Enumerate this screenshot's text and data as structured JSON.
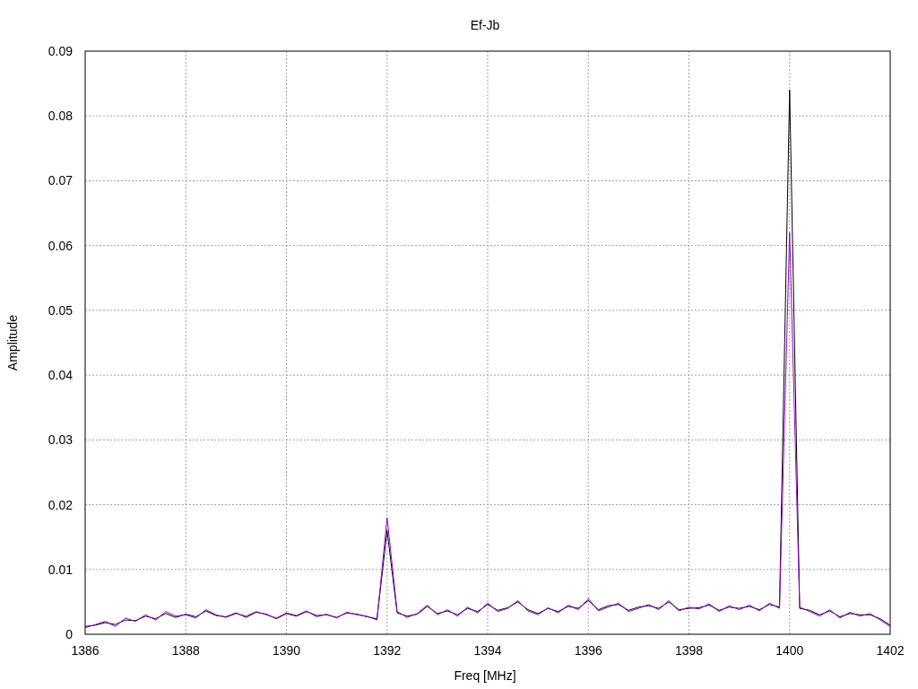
{
  "chart_data": {
    "type": "line",
    "title": "Ef-Jb",
    "xlabel": "Freq [MHz]",
    "ylabel": "Amplitude",
    "x": [
      1386,
      1386.2,
      1386.4,
      1386.6,
      1386.8,
      1387,
      1387.2,
      1387.4,
      1387.6,
      1387.8,
      1388,
      1388.2,
      1388.4,
      1388.6,
      1388.8,
      1389,
      1389.2,
      1389.4,
      1389.6,
      1389.8,
      1390,
      1390.2,
      1390.4,
      1390.6,
      1390.8,
      1391,
      1391.2,
      1391.4,
      1391.6,
      1391.8,
      1392,
      1392.2,
      1392.4,
      1392.6,
      1392.8,
      1393,
      1393.2,
      1393.4,
      1393.6,
      1393.8,
      1394,
      1394.2,
      1394.4,
      1394.6,
      1394.8,
      1395,
      1395.2,
      1395.4,
      1395.6,
      1395.8,
      1396,
      1396.2,
      1396.4,
      1396.6,
      1396.8,
      1397,
      1397.2,
      1397.4,
      1397.6,
      1397.8,
      1398,
      1398.2,
      1398.4,
      1398.6,
      1398.8,
      1399,
      1399.2,
      1399.4,
      1399.6,
      1399.8,
      1400,
      1400.2,
      1400.4,
      1400.6,
      1400.8,
      1401,
      1401.2,
      1401.4,
      1401.6,
      1401.8,
      1402
    ],
    "series": [
      {
        "color": "#000000",
        "values": [
          0.0012,
          0.0014,
          0.0018,
          0.0015,
          0.0022,
          0.0021,
          0.0028,
          0.0024,
          0.0032,
          0.0026,
          0.0031,
          0.0027,
          0.0036,
          0.0029,
          0.0027,
          0.0033,
          0.0026,
          0.0034,
          0.0031,
          0.0024,
          0.0032,
          0.0028,
          0.0035,
          0.0029,
          0.003,
          0.0026,
          0.0033,
          0.0031,
          0.0027,
          0.0024,
          0.016,
          0.0033,
          0.0028,
          0.0031,
          0.0043,
          0.0032,
          0.0036,
          0.003,
          0.004,
          0.0035,
          0.0046,
          0.0037,
          0.0041,
          0.005,
          0.0038,
          0.0032,
          0.004,
          0.0035,
          0.0043,
          0.004,
          0.0052,
          0.0038,
          0.0044,
          0.0046,
          0.0037,
          0.0042,
          0.0044,
          0.004,
          0.005,
          0.0038,
          0.004,
          0.0041,
          0.0045,
          0.0037,
          0.0042,
          0.004,
          0.0043,
          0.0038,
          0.0046,
          0.0042,
          0.084,
          0.004,
          0.0037,
          0.003,
          0.0036,
          0.0027,
          0.0032,
          0.003,
          0.003,
          0.0024,
          0.0014
        ]
      },
      {
        "color": "#9400d3",
        "values": [
          0.001,
          0.0015,
          0.002,
          0.0012,
          0.0025,
          0.002,
          0.003,
          0.0022,
          0.0035,
          0.0028,
          0.003,
          0.0025,
          0.0038,
          0.003,
          0.0026,
          0.0032,
          0.0028,
          0.0035,
          0.003,
          0.0025,
          0.0033,
          0.0029,
          0.0036,
          0.0027,
          0.0031,
          0.0025,
          0.0034,
          0.003,
          0.0028,
          0.0022,
          0.018,
          0.0035,
          0.0026,
          0.0032,
          0.0045,
          0.003,
          0.0038,
          0.0028,
          0.0042,
          0.0033,
          0.0048,
          0.0035,
          0.004,
          0.0052,
          0.0036,
          0.003,
          0.0041,
          0.0033,
          0.0045,
          0.0038,
          0.0055,
          0.0036,
          0.0042,
          0.0048,
          0.0035,
          0.004,
          0.0046,
          0.0038,
          0.0052,
          0.0036,
          0.0042,
          0.0039,
          0.0047,
          0.0035,
          0.0044,
          0.0038,
          0.0045,
          0.0036,
          0.0048,
          0.004,
          0.062,
          0.0042,
          0.0035,
          0.0028,
          0.0038,
          0.0025,
          0.0034,
          0.0028,
          0.0032,
          0.0022,
          0.0012
        ]
      }
    ],
    "grid": true,
    "xlim": [
      1386,
      1402
    ],
    "ylim": [
      0,
      0.09
    ],
    "xticks": [
      1386,
      1388,
      1390,
      1392,
      1394,
      1396,
      1398,
      1400,
      1402
    ],
    "yticks": [
      {
        "value": 0,
        "label": "0"
      },
      {
        "value": 0.01,
        "label": "0.01"
      },
      {
        "value": 0.02,
        "label": "0.02"
      },
      {
        "value": 0.03,
        "label": "0.03"
      },
      {
        "value": 0.04,
        "label": "0.04"
      },
      {
        "value": 0.05,
        "label": "0.05"
      },
      {
        "value": 0.06,
        "label": "0.06"
      },
      {
        "value": 0.07,
        "label": "0.07"
      },
      {
        "value": 0.08,
        "label": "0.08"
      },
      {
        "value": 0.09,
        "label": "0.09"
      }
    ]
  }
}
